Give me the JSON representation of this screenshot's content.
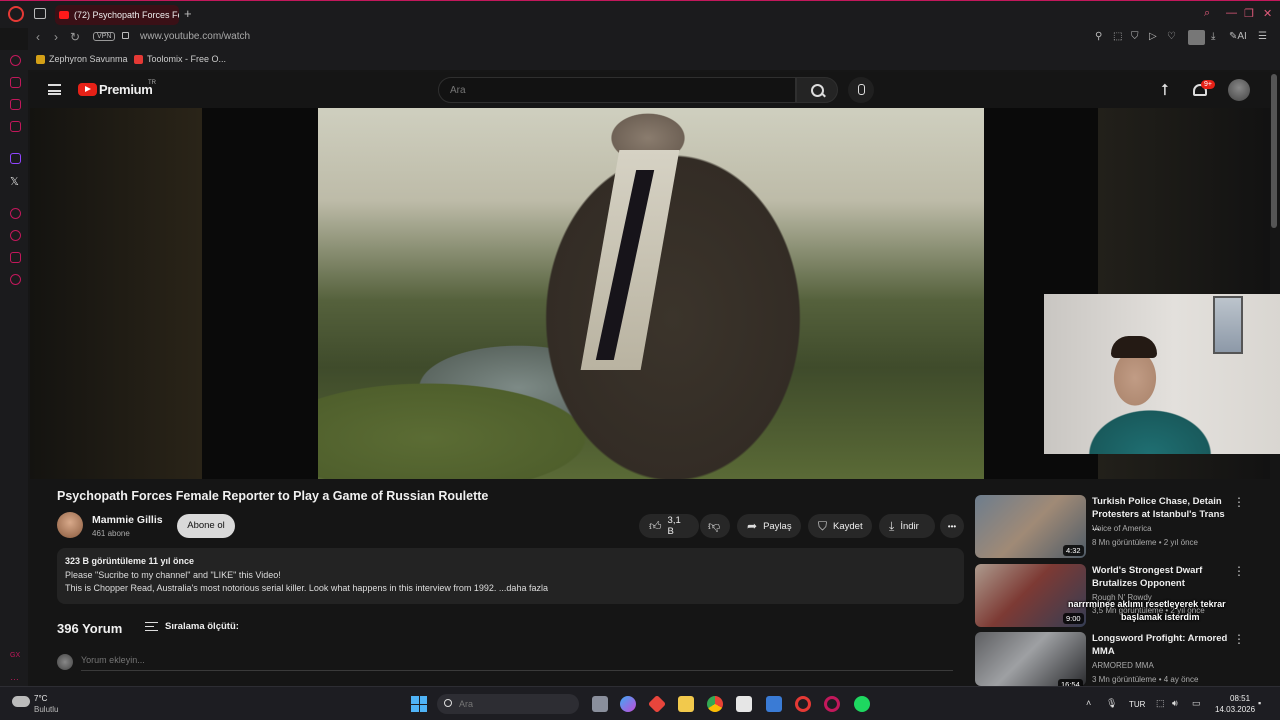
{
  "browser": {
    "tab_title": "(72) Psychopath Forces Fe",
    "tab_add": "+",
    "url": "www.youtube.com/watch",
    "vpn_label": "VPN",
    "ai_label": "AI",
    "bookmarks": [
      {
        "label": "Zephyron Savunma"
      },
      {
        "label": "Toolomix - Free O..."
      }
    ]
  },
  "youtube": {
    "brand": "Premium",
    "region": "TR",
    "search_placeholder": "Ara",
    "notif_count": "9+"
  },
  "video": {
    "title": "Psychopath Forces Female Reporter to Play a Game of Russian Roulette",
    "channel_name": "Mammie Gillis",
    "subscribers": "461 abone",
    "subscribe_label": "Abone ol",
    "likes": "3,1 B",
    "share_label": "Paylaş",
    "save_label": "Kaydet",
    "download_label": "İndir",
    "more_label": "•••",
    "stats": "323 B görüntüleme  11 yıl önce",
    "desc_line1": "Please \"Sucribe to my channel\" and \"LIKE\" this Video!",
    "desc_line2": "This is Chopper Read, Australia's most notorious serial killer. Look what happens in this interview from 1992. ...daha fazla"
  },
  "comments": {
    "count": "396 Yorum",
    "sort_label": "Sıralama ölçütü:",
    "input_placeholder": "Yorum ekleyin..."
  },
  "recommendations": [
    {
      "title": "Turkish Police Chase, Detain Protesters at Istanbul's Trans ...",
      "channel": "Voice of America",
      "meta": "8 Mn görüntüleme • 2 yıl önce",
      "duration": "4:32"
    },
    {
      "title": "World's Strongest Dwarf Brutalizes Opponent",
      "channel": "Rough N' Rowdy",
      "meta": "3,5 Mn görüntüleme • 2 yıl önce",
      "duration": "9:00"
    },
    {
      "title": "Longsword Profight: Armored MMA",
      "channel": "ARMORED MMA",
      "meta": "3 Mn görüntüleme • 4 ay önce",
      "duration": "16:54"
    }
  ],
  "chat_overlay": {
    "line1": "narrrminee  aklımı resetleyerek tekrar",
    "line2": "başlamak isterdim"
  },
  "taskbar": {
    "weather_temp": "7°C",
    "weather_desc": "Bulutlu",
    "search_placeholder": "Ara",
    "language": "TUR",
    "time": "08:51",
    "date": "14.03.2026"
  }
}
